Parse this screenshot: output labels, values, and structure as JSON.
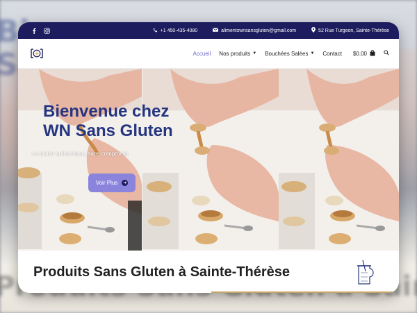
{
  "backdrop": {
    "top_text": "Bienvenue\nSa",
    "bottom_text": "Produits Sans Gluten à Sainte-Thérèse"
  },
  "topbar": {
    "bg_color": "#1c1c5e",
    "social_icons": [
      "facebook-icon",
      "instagram-icon"
    ],
    "phone": "+1 450-435-4080",
    "email": "alimentswnsansgluten@gmail.com",
    "address": "52 Rue Turgeon, Sainte-Thérèse"
  },
  "navbar": {
    "menu": {
      "home": "Accueil",
      "products": "Nos produits",
      "bouchees": "Bouchées Salées",
      "contact": "Contact"
    },
    "cart_amount": "$0.00",
    "accent_color": "#6d66c9"
  },
  "hero": {
    "title_line1": "Bienvenue chez",
    "title_line2": "WN Sans Gluten",
    "subtitle": "Le plaisir authentique, sans compromis",
    "cta_label": "Voir Plus",
    "title_color": "#25357f",
    "cta_color": "#8b84dd"
  },
  "section": {
    "heading": "Produits Sans Gluten à Sainte-Thérèse",
    "accent_color": "#c8a46a"
  }
}
